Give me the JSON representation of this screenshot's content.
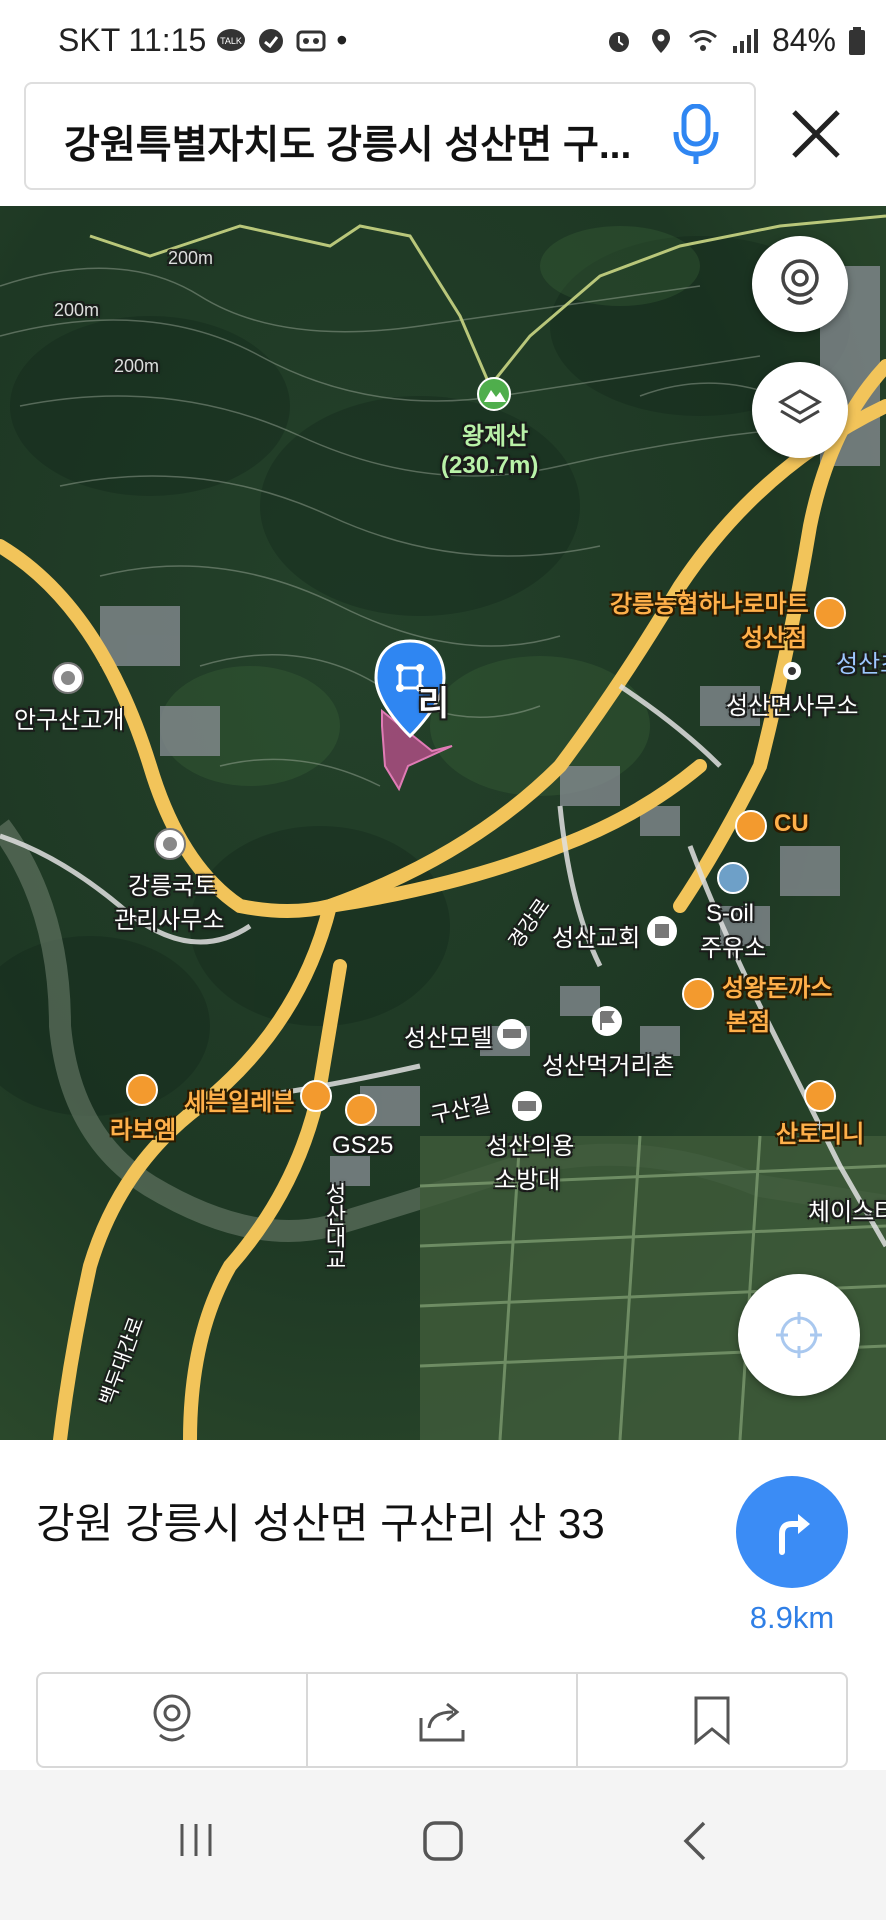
{
  "status_bar": {
    "carrier_time": "SKT 11:15",
    "dot": "•",
    "battery": "84%",
    "left_icons": [
      "talk-icon",
      "sync-icon",
      "voicemail-icon"
    ],
    "right_icons": [
      "alarm-icon",
      "location-icon",
      "wifi-icon",
      "signal-icon",
      "battery-icon"
    ]
  },
  "search": {
    "query": "강원특별자치도 강릉시 성산면 구..."
  },
  "map": {
    "contours": [
      "200m",
      "200m",
      "200m"
    ],
    "peak_name": "왕제산",
    "peak_height": "(230.7m)",
    "labels": {
      "nonghyup": "강릉농협하나로마트",
      "nonghyup2": "성산점",
      "seongsan_edge": "성산초",
      "office": "성산면사무소",
      "angusan": "안구산고개",
      "pin_partial": "리",
      "cu": "CU",
      "gangneung1": "강릉국토",
      "gangneung2": "관리사무소",
      "soil1": "S-oil",
      "soil2": "주유소",
      "church": "성산교회",
      "gyeonggang": "경강로",
      "seongwang1": "성왕돈까스",
      "seongwang2": "본점",
      "motel": "성산모텔",
      "meokgeori": "성산먹거리촌",
      "seven": "세븐일레븐",
      "rabo": "라보엠",
      "gusangil": "구산길",
      "gs25": "GS25",
      "fire1": "성산의용",
      "fire2": "소방대",
      "santorini": "산토리니",
      "chase": "체이스타",
      "daegyo": "성산대교",
      "baekdu": "백두대간로"
    }
  },
  "place": {
    "address": "강원 강릉시 성산면 구산리 산 33",
    "distance": "8.9km"
  },
  "colors": {
    "accent": "#3b8cf5",
    "road": "#f2c45a",
    "parcel": "#c0508f",
    "poi_orange": "#f39a2e"
  }
}
